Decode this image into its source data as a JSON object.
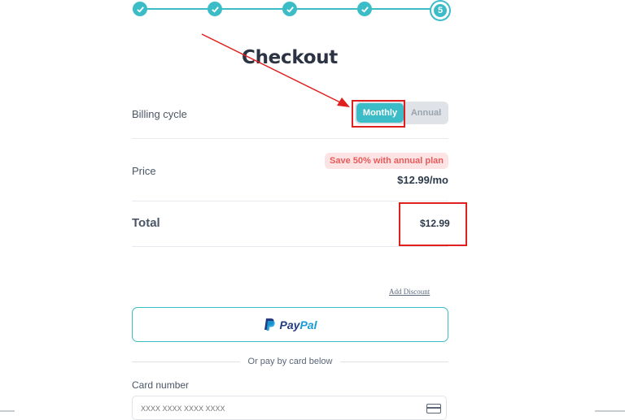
{
  "stepper": {
    "steps": [
      {
        "state": "done",
        "icon": "check-icon"
      },
      {
        "state": "done",
        "icon": "check-icon"
      },
      {
        "state": "done",
        "icon": "check-icon"
      },
      {
        "state": "done",
        "icon": "check-icon"
      },
      {
        "state": "current",
        "label": "5"
      }
    ]
  },
  "page": {
    "title": "Checkout"
  },
  "billing": {
    "label": "Billing cycle",
    "options": [
      "Monthly",
      "Annual"
    ],
    "selected": "Monthly"
  },
  "price": {
    "label": "Price",
    "badge": "Save 50% with annual plan",
    "value": "$12.99/mo"
  },
  "total": {
    "label": "Total",
    "value": "$12.99"
  },
  "discount": {
    "link": "Add Discount"
  },
  "paypal": {
    "word1": "Pay",
    "word2": "Pal"
  },
  "separator": {
    "text": "Or pay by card below"
  },
  "card": {
    "label": "Card number",
    "placeholder": "XXXX XXXX XXXX XXXX"
  },
  "colors": {
    "accent": "#3bbcc6",
    "annotation": "#e01f1f",
    "badge_bg": "#fde3e3",
    "badge_text": "#e85b5b"
  }
}
